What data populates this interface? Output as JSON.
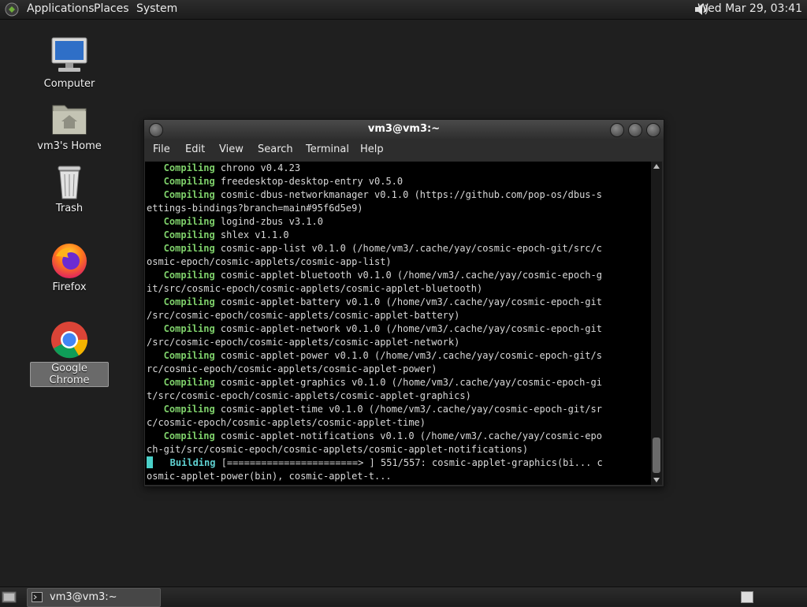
{
  "top_panel": {
    "menus": [
      "Applications",
      "Places",
      "System"
    ],
    "clock": "Wed Mar 29, 03:41"
  },
  "desktop": {
    "icons": [
      {
        "label": "Computer",
        "icon": "computer-icon"
      },
      {
        "label": "vm3's Home",
        "icon": "home-folder-icon"
      },
      {
        "label": "Trash",
        "icon": "trash-icon"
      },
      {
        "label": "Firefox",
        "icon": "firefox-icon"
      },
      {
        "label": "Google Chrome",
        "icon": "chrome-icon",
        "selected": true
      }
    ]
  },
  "terminal": {
    "title": "vm3@vm3:~",
    "menu": [
      "File",
      "Edit",
      "View",
      "Search",
      "Terminal",
      "Help"
    ],
    "lines": [
      {
        "kw": "Compiling",
        "text": " chrono v0.4.23"
      },
      {
        "kw": "Compiling",
        "text": " freedesktop-desktop-entry v0.5.0"
      },
      {
        "kw": "Compiling",
        "text": " cosmic-dbus-networkmanager v0.1.0 (https://github.com/pop-os/dbus-s"
      },
      {
        "text": "ettings-bindings?branch=main#95f6d5e9)"
      },
      {
        "kw": "Compiling",
        "text": " logind-zbus v3.1.0"
      },
      {
        "kw": "Compiling",
        "text": " shlex v1.1.0"
      },
      {
        "kw": "Compiling",
        "text": " cosmic-app-list v0.1.0 (/home/vm3/.cache/yay/cosmic-epoch-git/src/c"
      },
      {
        "text": "osmic-epoch/cosmic-applets/cosmic-app-list)"
      },
      {
        "kw": "Compiling",
        "text": " cosmic-applet-bluetooth v0.1.0 (/home/vm3/.cache/yay/cosmic-epoch-g"
      },
      {
        "text": "it/src/cosmic-epoch/cosmic-applets/cosmic-applet-bluetooth)"
      },
      {
        "kw": "Compiling",
        "text": " cosmic-applet-battery v0.1.0 (/home/vm3/.cache/yay/cosmic-epoch-git"
      },
      {
        "text": "/src/cosmic-epoch/cosmic-applets/cosmic-applet-battery)"
      },
      {
        "kw": "Compiling",
        "text": " cosmic-applet-network v0.1.0 (/home/vm3/.cache/yay/cosmic-epoch-git"
      },
      {
        "text": "/src/cosmic-epoch/cosmic-applets/cosmic-applet-network)"
      },
      {
        "kw": "Compiling",
        "text": " cosmic-applet-power v0.1.0 (/home/vm3/.cache/yay/cosmic-epoch-git/s"
      },
      {
        "text": "rc/cosmic-epoch/cosmic-applets/cosmic-applet-power)"
      },
      {
        "kw": "Compiling",
        "text": " cosmic-applet-graphics v0.1.0 (/home/vm3/.cache/yay/cosmic-epoch-gi"
      },
      {
        "text": "t/src/cosmic-epoch/cosmic-applets/cosmic-applet-graphics)"
      },
      {
        "kw": "Compiling",
        "text": " cosmic-applet-time v0.1.0 (/home/vm3/.cache/yay/cosmic-epoch-git/sr"
      },
      {
        "text": "c/cosmic-epoch/cosmic-applets/cosmic-applet-time)"
      },
      {
        "kw": "Compiling",
        "text": " cosmic-applet-notifications v0.1.0 (/home/vm3/.cache/yay/cosmic-epo"
      },
      {
        "text": "ch-git/src/cosmic-epoch/cosmic-applets/cosmic-applet-notifications)"
      },
      {
        "kw": "Building",
        "text": " [=======================> ] 551/557: cosmic-applet-graphics(bi... c",
        "cursor": true
      },
      {
        "text": "osmic-applet-power(bin), cosmic-applet-t..."
      }
    ]
  },
  "taskbar": {
    "task_label": "vm3@vm3:~"
  }
}
